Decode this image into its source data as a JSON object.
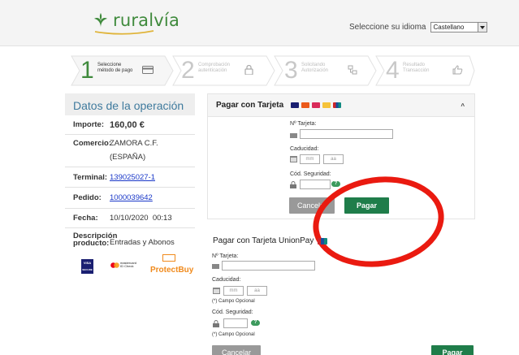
{
  "header": {
    "logo_text": "ruralvía",
    "language_prompt": "Seleccione su idioma",
    "language_selected": "Castellano",
    "brand_color": "#3f8a3c"
  },
  "steps": [
    {
      "number": "1",
      "label_line1": "Seleccione",
      "label_line2": "método de pago",
      "icon": "card-icon",
      "active": true
    },
    {
      "number": "2",
      "label_line1": "Comprobación",
      "label_line2": "autenticación",
      "icon": "lock-icon",
      "active": false
    },
    {
      "number": "3",
      "label_line1": "Solicitando",
      "label_line2": "Autorización",
      "icon": "network-icon",
      "active": false
    },
    {
      "number": "4",
      "label_line1": "Resultado",
      "label_line2": "Transacción",
      "icon": "thumbs-up-icon",
      "active": false
    }
  ],
  "operation": {
    "title": "Datos de la operación",
    "rows": [
      {
        "label": "Importe:",
        "value": "160,00 €"
      },
      {
        "label": "Comercio:",
        "value": "ZAMORA C.F.",
        "value2": "(ESPAÑA)"
      },
      {
        "label": "Terminal:",
        "value": "139025027-1"
      },
      {
        "label": "Pedido:",
        "value": "1000039642"
      },
      {
        "label": "Fecha:",
        "value": "10/10/2020  00:13"
      },
      {
        "label": "Descripción",
        "label2": "producto:",
        "value": "Entradas y Abonos"
      }
    ]
  },
  "security_logos": {
    "visa": "VISA",
    "visa_sub": "SECURE",
    "mastercard": "mastercard",
    "mastercard_sub": "ID Check",
    "protect": "ProtectBuy"
  },
  "card_payment": {
    "title": "Pagar con Tarjeta",
    "card_number_label": "Nº Tarjeta:",
    "expiry_label": "Caducidad:",
    "month_placeholder": "mm",
    "year_placeholder": "aa",
    "cvv_label": "Cód. Seguridad:",
    "help": "?",
    "cancel": "Cancelar",
    "pay": "Pagar"
  },
  "unionpay_payment": {
    "title": "Pagar con Tarjeta UnionPay",
    "card_number_label": "Nº Tarjeta:",
    "expiry_label": "Caducidad:",
    "month_placeholder": "mm",
    "year_placeholder": "aa",
    "optional1": "(*) Campo Opcional",
    "cvv_label": "Cód. Seguridad:",
    "help": "?",
    "optional2": "(*) Campo Opcional",
    "cancel": "Cancelar",
    "pay": "Pagar"
  },
  "colors": {
    "accent_green": "#1f7d4a",
    "annotation_red": "#ea1a10",
    "title_blue": "#3f7a9d"
  }
}
